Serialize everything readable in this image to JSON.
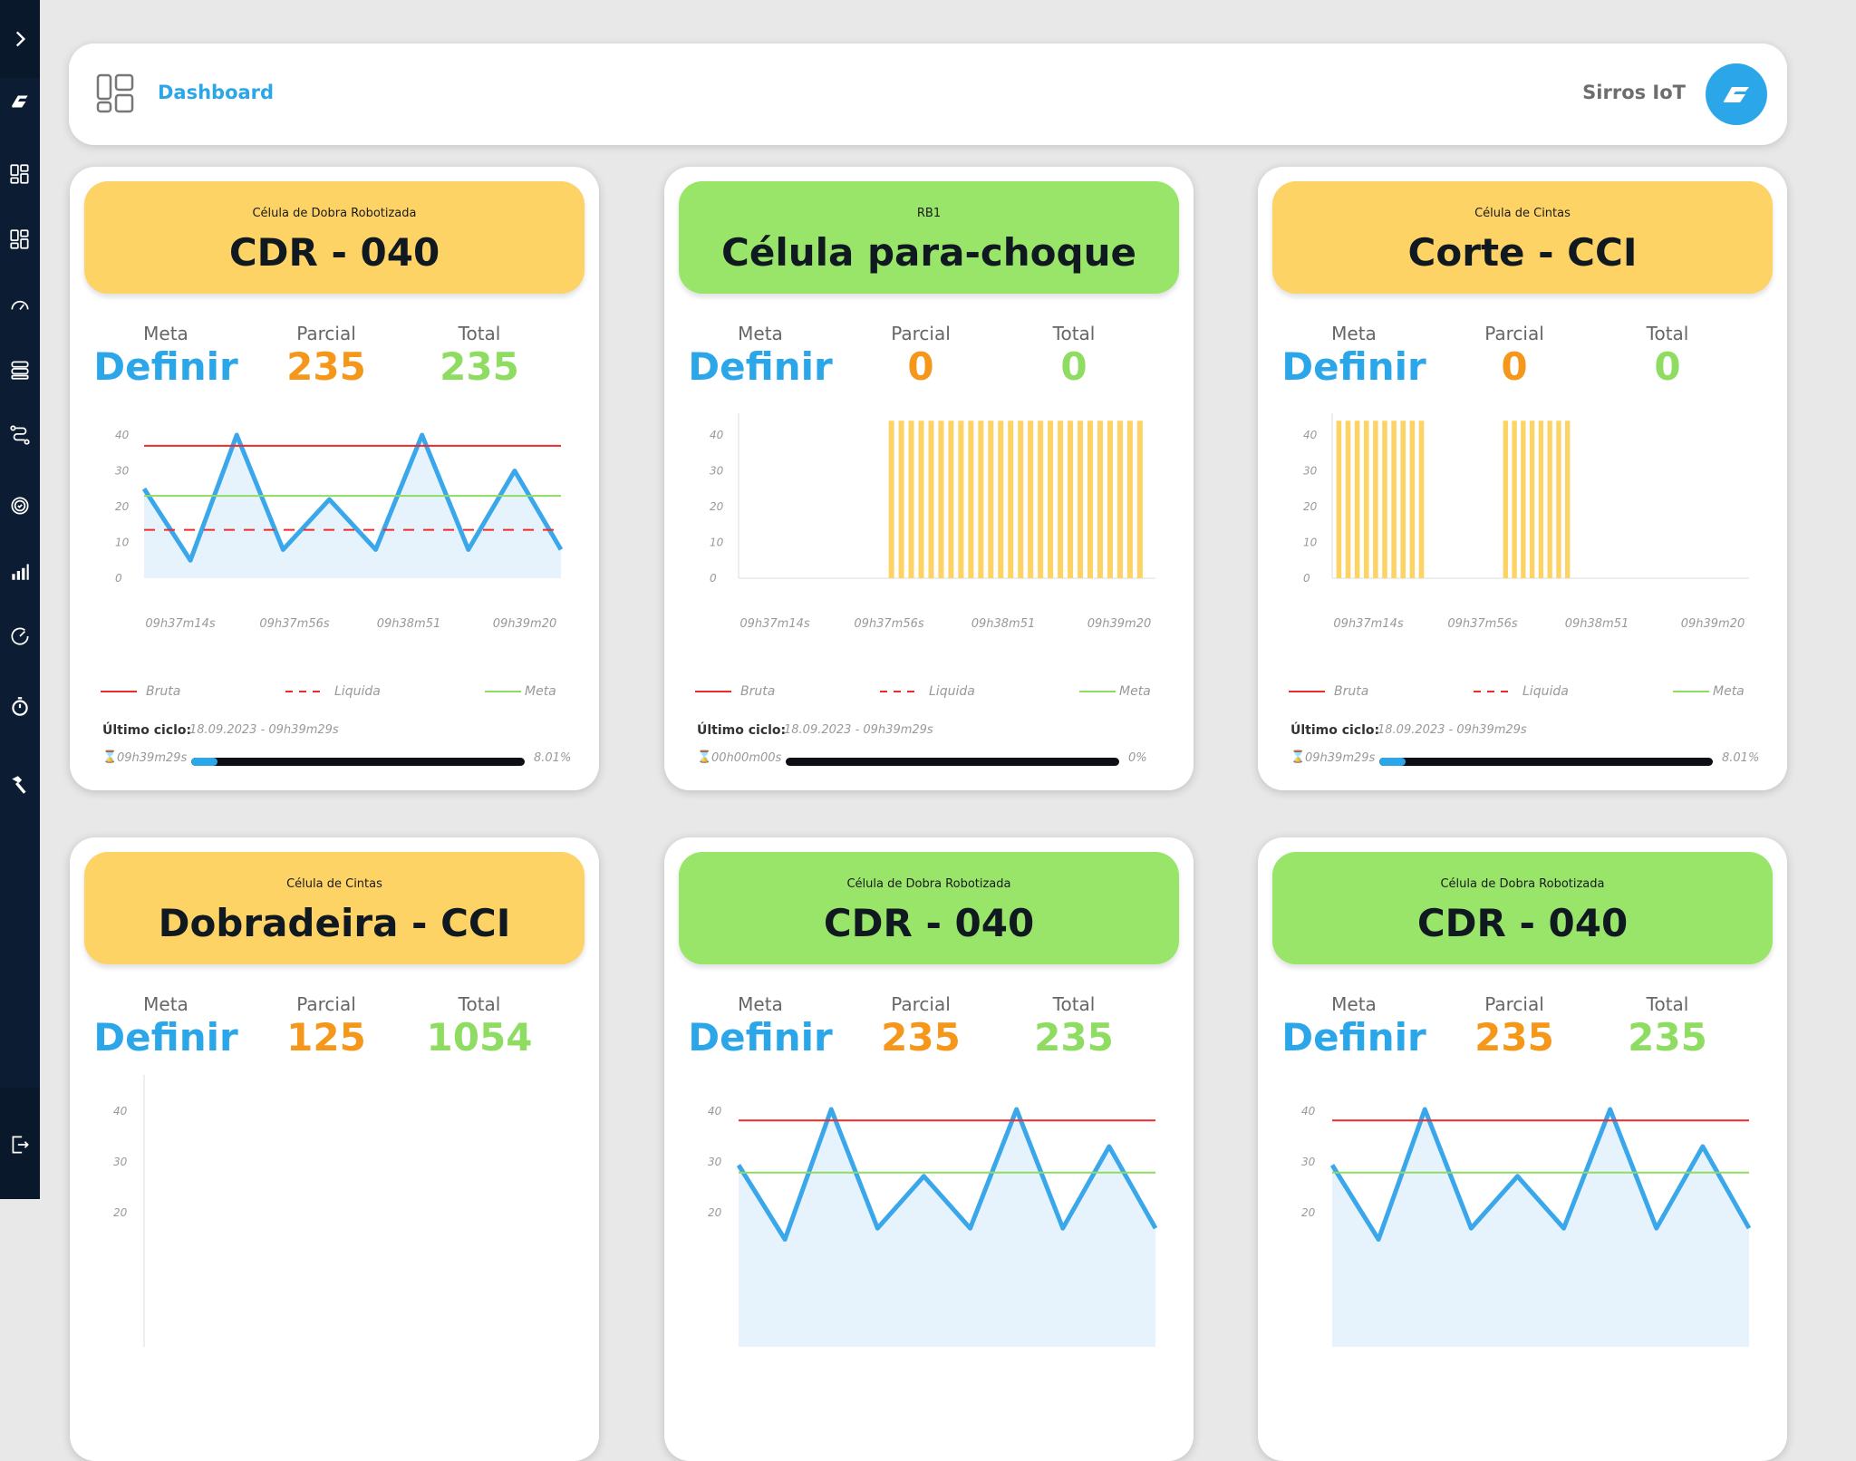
{
  "header": {
    "title": "Dashboard",
    "brand": "Sirros IoT",
    "icons": [
      "dashboard-icon",
      "sirros-logo"
    ]
  },
  "sidebar": {
    "items": [
      {
        "icon": "expand-chevron-icon"
      },
      {
        "icon": "sirros-logo-icon"
      },
      {
        "icon": "dashboard-icon"
      },
      {
        "icon": "dashboard-alt-icon"
      },
      {
        "icon": "gauge-icon"
      },
      {
        "icon": "server-icon"
      },
      {
        "icon": "route-icon"
      },
      {
        "icon": "gear-check-icon"
      },
      {
        "icon": "bar-chart-icon"
      },
      {
        "icon": "speedometer-icon"
      },
      {
        "icon": "stopwatch-icon"
      },
      {
        "icon": "hammer-icon"
      },
      {
        "icon": "logout-icon"
      }
    ]
  },
  "colors": {
    "accent": "#2ba6e8",
    "banner_yellow": "#fdd366",
    "banner_green": "#98e56a",
    "parcial": "#f4971a",
    "total": "#8fdc62",
    "bruta": "#ef2a2a",
    "meta_line": "#8fdc62"
  },
  "labels": {
    "meta": "Meta",
    "parcial": "Parcial",
    "total": "Total",
    "legend_bruta": "Bruta",
    "legend_liquida": "Liquida",
    "legend_meta": "Meta",
    "last_cycle": "Último ciclo:"
  },
  "cards": [
    {
      "subtitle": "Célula de Dobra Robotizada",
      "title": "CDR - 040",
      "banner_color": "yellow",
      "meta": "Definir",
      "parcial": "235",
      "total": "235",
      "last_cycle": "18.09.2023 - 09h39m29s",
      "elapsed": "09h39m29s",
      "progress_text": "8.01%",
      "progress": 0.0801
    },
    {
      "subtitle": "RB1",
      "title": "Célula para-choque",
      "banner_color": "green",
      "meta": "Definir",
      "parcial": "0",
      "total": "0",
      "last_cycle": "18.09.2023 - 09h39m29s",
      "elapsed": "00h00m00s",
      "progress_text": "0%",
      "progress": 0
    },
    {
      "subtitle": "Célula de Cintas",
      "title": "Corte - CCI",
      "banner_color": "yellow",
      "meta": "Definir",
      "parcial": "0",
      "total": "0",
      "last_cycle": "18.09.2023 - 09h39m29s",
      "elapsed": "09h39m29s",
      "progress_text": "8.01%",
      "progress": 0.0801
    },
    {
      "subtitle": "Célula de Cintas",
      "title": "Dobradeira - CCI",
      "banner_color": "yellow",
      "meta": "Definir",
      "parcial": "125",
      "total": "1054"
    },
    {
      "subtitle": "Célula de Dobra Robotizada",
      "title": "CDR - 040",
      "banner_color": "green",
      "meta": "Definir",
      "parcial": "235",
      "total": "235"
    },
    {
      "subtitle": "Célula de Dobra Robotizada",
      "title": "CDR - 040",
      "banner_color": "green",
      "meta": "Definir",
      "parcial": "235",
      "total": "235"
    }
  ],
  "chart_data": [
    {
      "type": "line",
      "card": 0,
      "x_ticks": [
        "09h37m14s",
        "09h37m56s",
        "09h38m51",
        "09h39m20"
      ],
      "y_ticks": [
        "0",
        "10",
        "20",
        "30",
        "40"
      ],
      "ylim": [
        0,
        40
      ],
      "series": [
        {
          "name": "Bruta",
          "style": "solid-red",
          "values": [
            37,
            37
          ]
        },
        {
          "name": "Liquida",
          "style": "dashed-red",
          "values": [
            13.5,
            13.5
          ]
        },
        {
          "name": "Meta",
          "style": "solid-green",
          "values": [
            23,
            23
          ]
        },
        {
          "values": [
            25,
            5,
            40,
            8,
            22,
            8,
            40,
            8,
            30,
            8
          ]
        }
      ]
    },
    {
      "type": "bar",
      "card": 1,
      "x_ticks": [
        "09h37m14s",
        "09h37m56s",
        "09h38m51",
        "09h39m20"
      ],
      "y_ticks": [
        "0",
        "10",
        "20",
        "30",
        "40"
      ],
      "ylim": [
        0,
        40
      ],
      "bar_groups": [
        {
          "from": 0.36,
          "to": 0.98,
          "count": 26,
          "value": 44
        }
      ]
    },
    {
      "type": "bar",
      "card": 2,
      "x_ticks": [
        "09h37m14s",
        "09h37m56s",
        "09h38m51",
        "09h39m20"
      ],
      "y_ticks": [
        "0",
        "10",
        "20",
        "30",
        "40"
      ],
      "ylim": [
        0,
        40
      ],
      "bar_groups": [
        {
          "from": 0.01,
          "to": 0.23,
          "count": 10,
          "value": 44
        },
        {
          "from": 0.41,
          "to": 0.58,
          "count": 8,
          "value": 44
        }
      ]
    },
    {
      "type": "line",
      "card": 3,
      "y_ticks": [
        "40",
        "30",
        "20"
      ],
      "ylim": [
        0,
        40
      ],
      "series": []
    },
    {
      "type": "line",
      "card": 4,
      "y_ticks": [
        "40",
        "30",
        "20"
      ],
      "ylim": [
        0,
        40
      ],
      "series": [
        {
          "name": "Bruta",
          "style": "solid-red",
          "values": [
            37,
            37
          ]
        },
        {
          "name": "Meta",
          "style": "solid-green",
          "values": [
            23,
            23
          ]
        },
        {
          "values": [
            25,
            5,
            40,
            8,
            22,
            8,
            40,
            8,
            30,
            8
          ]
        }
      ]
    },
    {
      "type": "line",
      "card": 5,
      "y_ticks": [
        "40",
        "30",
        "20"
      ],
      "ylim": [
        0,
        40
      ],
      "series": [
        {
          "name": "Bruta",
          "style": "solid-red",
          "values": [
            37,
            37
          ]
        },
        {
          "name": "Meta",
          "style": "solid-green",
          "values": [
            23,
            23
          ]
        },
        {
          "values": [
            25,
            5,
            40,
            8,
            22,
            8,
            40,
            8,
            30,
            8
          ]
        }
      ]
    }
  ]
}
